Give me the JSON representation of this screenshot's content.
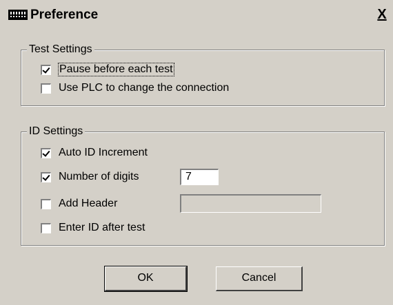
{
  "window": {
    "title": "Preference",
    "close_label": "X"
  },
  "test_settings": {
    "legend": "Test Settings",
    "options": [
      {
        "label": "Pause before each test",
        "checked": true
      },
      {
        "label": "Use PLC to change the connection",
        "checked": false
      }
    ]
  },
  "id_settings": {
    "legend": "ID Settings",
    "auto_increment": {
      "label": "Auto ID Increment",
      "checked": true
    },
    "number_of_digits": {
      "label": "Number of digits",
      "checked": true,
      "value": "7"
    },
    "add_header": {
      "label": "Add Header",
      "checked": false,
      "value": ""
    },
    "enter_id_after_test": {
      "label": "Enter ID after test",
      "checked": false
    }
  },
  "buttons": {
    "ok_label": "OK",
    "cancel_label": "Cancel"
  }
}
